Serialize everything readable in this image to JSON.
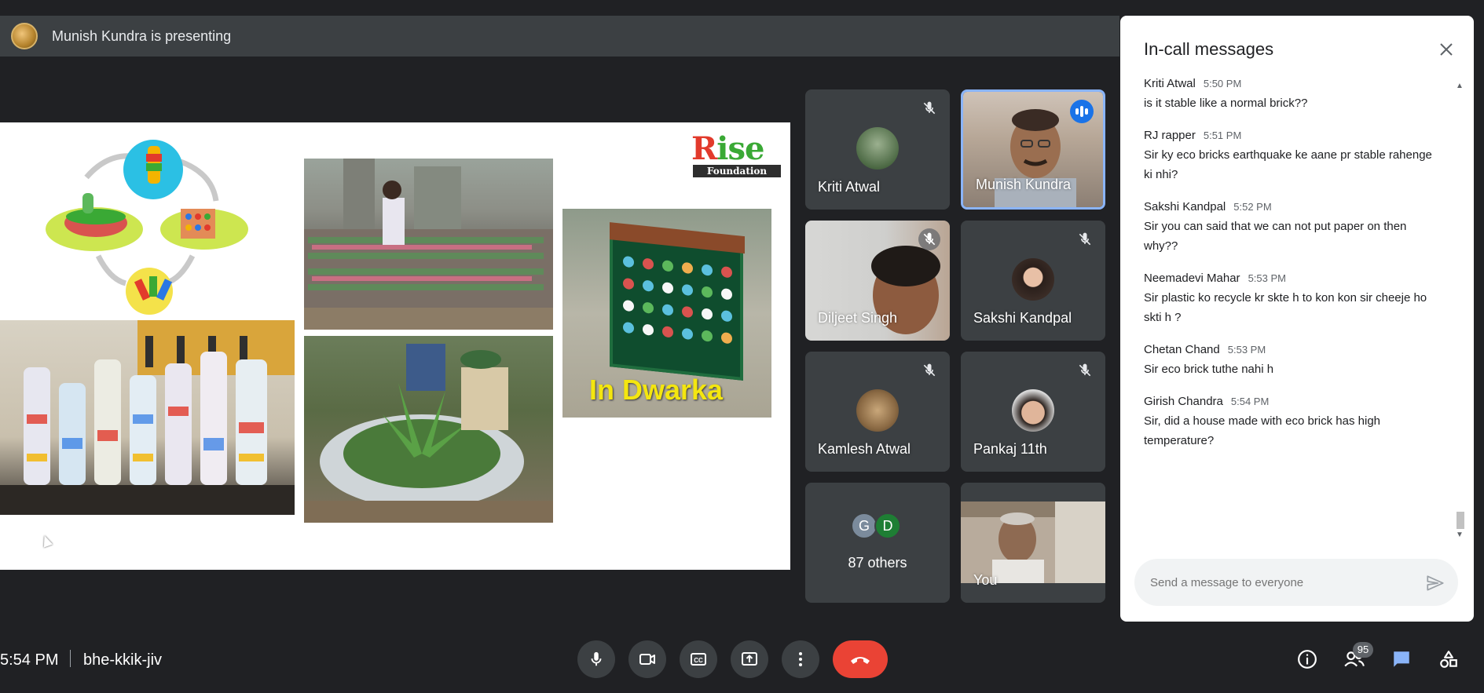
{
  "presenting": {
    "text": "Munish Kundra is presenting"
  },
  "slide": {
    "logo_word_r": "R",
    "logo_word_rest": "ise",
    "logo_sub": "Foundation",
    "caption": "In Dwarka"
  },
  "participants": [
    {
      "name": "Kriti Atwal",
      "muted": true
    },
    {
      "name": "Munish Kundra",
      "speaking": true
    },
    {
      "name": "Diljeet Singh",
      "muted": true
    },
    {
      "name": "Sakshi Kandpal",
      "muted": true
    },
    {
      "name": "Kamlesh Atwal",
      "muted": true
    },
    {
      "name": "Pankaj 11th",
      "muted": true
    },
    {
      "name": "You"
    }
  ],
  "others": {
    "avatars": [
      "G",
      "D"
    ],
    "label": "87 others",
    "avatar_colors": [
      "#7b8b9c",
      "#1e7e34"
    ]
  },
  "chat": {
    "title": "In-call messages",
    "messages": [
      {
        "sender": "Kriti Atwal",
        "time": "5:50 PM",
        "text": "is it stable like a normal brick??"
      },
      {
        "sender": "RJ rapper",
        "time": "5:51 PM",
        "text": "Sir ky eco bricks earthquake ke aane pr stable rahenge ki nhi?"
      },
      {
        "sender": "Sakshi Kandpal",
        "time": "5:52 PM",
        "text": "Sir you can said  that we can not put paper on then why??"
      },
      {
        "sender": "Neemadevi Mahar",
        "time": "5:53 PM",
        "text": "Sir plastic ko recycle kr skte h  to kon kon sir cheeje ho skti h ?"
      },
      {
        "sender": "Chetan Chand",
        "time": "5:53 PM",
        "text": "Sir eco brick tuthe nahi h"
      },
      {
        "sender": "Girish Chandra",
        "time": "5:54 PM",
        "text": "Sir, did a house made with eco brick has high temperature?"
      }
    ],
    "input_placeholder": "Send a message to everyone"
  },
  "bottom": {
    "time": "5:54 PM",
    "meeting_code": "bhe-kkik-jiv",
    "participant_count": "95"
  },
  "colors": {
    "background": "#202124",
    "tile": "#3c4043",
    "end_call": "#ea4335",
    "active_border": "#8ab4f8",
    "chat_icon": "#8ab4f8"
  },
  "icons": {
    "mic": "mic-icon",
    "camera": "camera-icon",
    "captions": "captions-icon",
    "present": "present-screen-icon",
    "more": "more-options-icon",
    "end": "end-call-icon",
    "info": "info-icon",
    "people": "people-icon",
    "chat": "chat-icon",
    "activities": "activities-icon"
  }
}
